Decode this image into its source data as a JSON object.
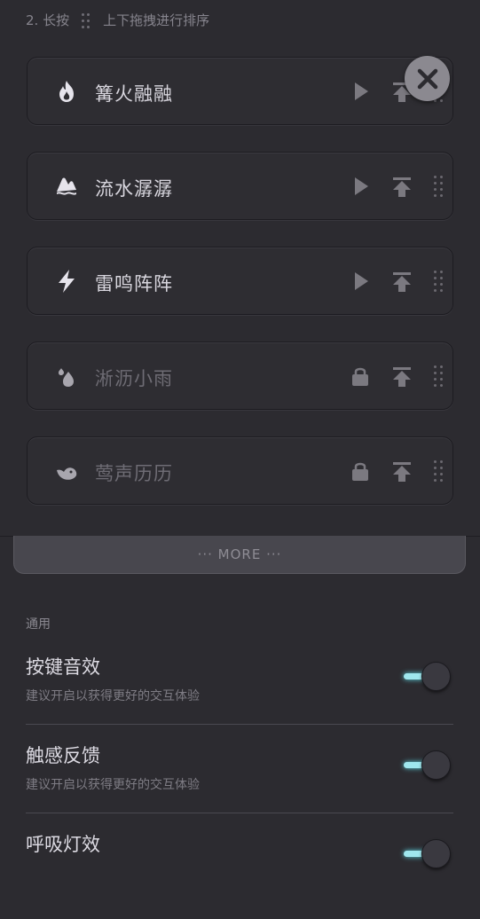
{
  "hint": {
    "step": "2. 长按",
    "text": "上下拖拽进行排序"
  },
  "sounds": [
    {
      "label": "篝火融融",
      "icon": "fire-icon",
      "locked": false
    },
    {
      "label": "流水潺潺",
      "icon": "water-icon",
      "locked": false
    },
    {
      "label": "雷鸣阵阵",
      "icon": "lightning-icon",
      "locked": false
    },
    {
      "label": "淅沥小雨",
      "icon": "rain-icon",
      "locked": true
    },
    {
      "label": "莺声历历",
      "icon": "bird-icon",
      "locked": true
    }
  ],
  "more": {
    "label": "··· MORE ···"
  },
  "settings_section": {
    "title": "通用"
  },
  "settings": [
    {
      "title": "按键音效",
      "subtitle": "建议开启以获得更好的交互体验",
      "enabled": true
    },
    {
      "title": "触感反馈",
      "subtitle": "建议开启以获得更好的交互体验",
      "enabled": true
    },
    {
      "title": "呼吸灯效",
      "subtitle": "",
      "enabled": true
    }
  ],
  "colors": {
    "background": "#2c2b30",
    "accent": "#9fe7ee"
  }
}
